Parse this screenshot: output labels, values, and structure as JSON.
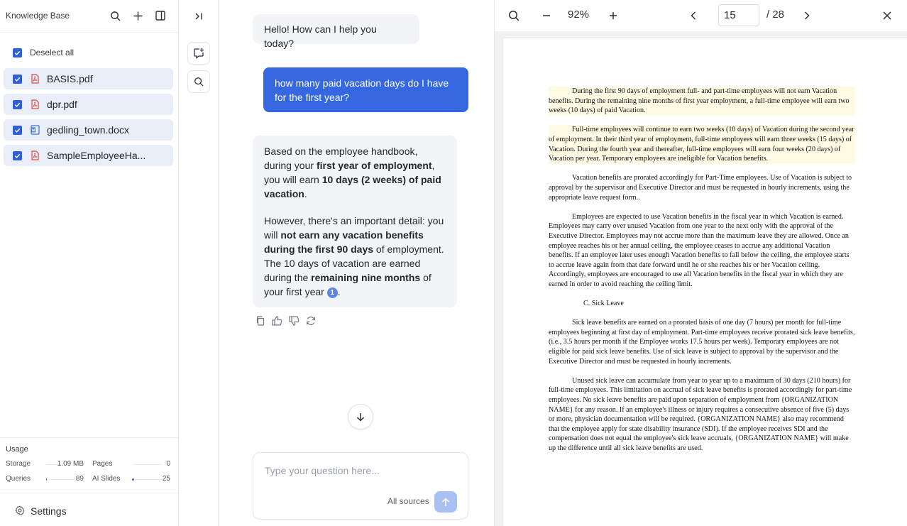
{
  "sidebar": {
    "title": "Knowledge Base",
    "deselect_label": "Deselect all",
    "files": [
      {
        "name": "BASIS.pdf",
        "type": "pdf"
      },
      {
        "name": "dpr.pdf",
        "type": "pdf"
      },
      {
        "name": "gedling_town.docx",
        "type": "docx"
      },
      {
        "name": "SampleEmployeeHa...",
        "type": "pdf"
      }
    ],
    "usage": {
      "title": "Usage",
      "storage_label": "Storage",
      "storage_value": "1.09 MB",
      "storage_fraction": 0.0,
      "pages_label": "Pages",
      "pages_value": "0",
      "pages_fraction": 0.0,
      "queries_label": "Queries",
      "queries_value": "89",
      "queries_fraction": 0.02,
      "slides_label": "AI Slides",
      "slides_value": "25",
      "slides_fraction": 0.06
    },
    "settings_label": "Settings"
  },
  "chat": {
    "greeting": "Hello! How can I help you today?",
    "user_message": "how many paid vacation days do I have for the first year?",
    "answer_p1": [
      {
        "t": "Based on the employee handbook, during your "
      },
      {
        "t": "first year of employment",
        "b": true
      },
      {
        "t": ", you will earn "
      },
      {
        "t": "10 days (2 weeks) of paid vacation",
        "b": true
      },
      {
        "t": "."
      }
    ],
    "answer_p2": [
      {
        "t": "However, there's an important detail: you will "
      },
      {
        "t": "not earn any vacation benefits during the first 90 days",
        "b": true
      },
      {
        "t": " of employment. The 10 days of vacation are earned during the "
      },
      {
        "t": "remaining nine months",
        "b": true
      },
      {
        "t": " of your first year "
      }
    ],
    "citation": "1",
    "input_placeholder": "Type your question here...",
    "sources_label": "All sources"
  },
  "viewer": {
    "zoom": "92%",
    "current_page": "15",
    "total_pages": "/ 28"
  },
  "document": {
    "paragraphs": [
      {
        "text": "During the first 90 days of employment full- and part-time employees will not earn Vacation benefits.  During the remaining nine months of first year employment, a full-time employee will earn two weeks (10 days) of paid Vacation.",
        "highlight": true
      },
      {
        "text": "Full-time employees will continue to earn two weeks (10 days) of Vacation during the second year of employment.  In their third year of employment, full-time employees will earn three weeks (15 days) of Vacation.  During the fourth year and thereafter, full-time employees will earn four weeks (20 days) of Vacation per year.  Temporary employees are ineligible for Vacation benefits.",
        "highlight": true
      },
      {
        "text": "Vacation benefits are prorated accordingly for Part-Time employees.  Use of Vacation is subject to approval by the supervisor and Executive Director and must be requested in hourly increments, using the appropriate leave request form..",
        "highlight": false
      },
      {
        "text": "Employees are expected to use Vacation benefits in the fiscal year in which Vacation is earned.  Employees may carry over unused Vacation from one year to the next only with the approval of the Executive Director.  Employees may not accrue more than the maximum leave they are allowed.  Once an employee reaches his or her annual ceiling, the employee ceases to accrue any additional Vacation benefits.  If an employee later uses enough Vacation benefits to fall below the ceiling, the employee starts to accrue leave again from that date forward until he or she reaches his or her Vacation ceiling.  Accordingly, employees are encouraged to use all Vacation benefits in the fiscal year in which they are earned in order to avoid reaching the ceiling limit.",
        "highlight": false
      },
      {
        "text": "C.    Sick Leave",
        "highlight": false,
        "heading": true
      },
      {
        "text": "Sick leave benefits are earned on a prorated basis of one day (7 hours) per month for full-time employees beginning at first day of employment.  Part-time employees receive prorated sick leave benefits, (i.e., 3.5 hours per month if the Employee works 17.5 hours per week). Temporary employees are not eligible for paid sick leave benefits.  Use of sick leave is subject to approval by the supervisor and the Executive Director and must be requested in hourly increments.",
        "highlight": false
      },
      {
        "text": "Unused sick leave can accumulate from year to year up to a maximum of 30 days (210 hours) for full-time employees.  This limitation on accrual of sick leave benefits is prorated accordingly for part-time employees.  No sick leave benefits are paid upon separation of employment from {ORGANIZATION NAME} for any reason.  If an employee's illness or injury requires a consecutive absence of five (5) days or more, physician documentation will be required.  {ORGANIZATION NAME} also may recommend that the employee apply for state disability insurance (SDI).  If the employee receives SDI and the compensation does not equal the employee's sick leave accruals, {ORGANIZATION NAME} will make up the difference until all sick leave benefits are used.",
        "highlight": false
      }
    ]
  },
  "colors": {
    "accent": "#3567e0",
    "checkbox": "#2f5fd0",
    "file_row": "#e8edf7",
    "pdf_icon": "#e0473c",
    "docx_icon": "#3b6fd6",
    "highlight": "#fdfbe3"
  },
  "icons": [
    "search-icon",
    "plus-icon",
    "panel-toggle-icon",
    "collapse-right-icon",
    "new-chat-icon",
    "search-icon",
    "copy-icon",
    "thumbs-up-icon",
    "thumbs-down-icon",
    "refresh-icon",
    "arrow-down-icon",
    "send-arrow-icon",
    "zoom-out-icon",
    "zoom-in-icon",
    "chevron-left-icon",
    "chevron-right-icon",
    "close-icon",
    "gear-icon",
    "pdf-file-icon",
    "docx-file-icon",
    "checkbox-checked-icon"
  ]
}
